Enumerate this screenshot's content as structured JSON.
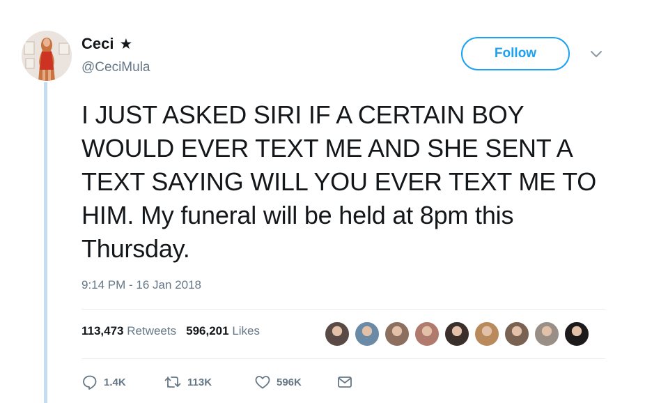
{
  "user": {
    "display_name": "Ceci",
    "star": "★",
    "handle": "@CeciMula",
    "avatar_icon": "profile-photo"
  },
  "follow_button": {
    "label": "Follow"
  },
  "tweet": {
    "text": "I JUST ASKED SIRI IF A CERTAIN BOY WOULD EVER TEXT ME AND SHE SENT A TEXT SAYING WILL YOU EVER TEXT ME TO HIM. My funeral will be held at 8pm this Thursday.",
    "timestamp": "9:14 PM - 16 Jan 2018"
  },
  "stats": {
    "retweets_count": "113,473",
    "retweets_label": "Retweets",
    "likes_count": "596,201",
    "likes_label": "Likes"
  },
  "liker_avatars": [
    "#5a4a46",
    "#6b8aa6",
    "#8d6f60",
    "#b07b6d",
    "#3a2f2b",
    "#b98a5c",
    "#7a6252",
    "#9a8f86",
    "#1c1a1a"
  ],
  "actions": {
    "replies": "1.4K",
    "retweets": "113K",
    "likes": "596K"
  },
  "colors": {
    "accent": "#1da1f2",
    "secondary_text": "#657786",
    "thread_line": "#c4dcef"
  }
}
